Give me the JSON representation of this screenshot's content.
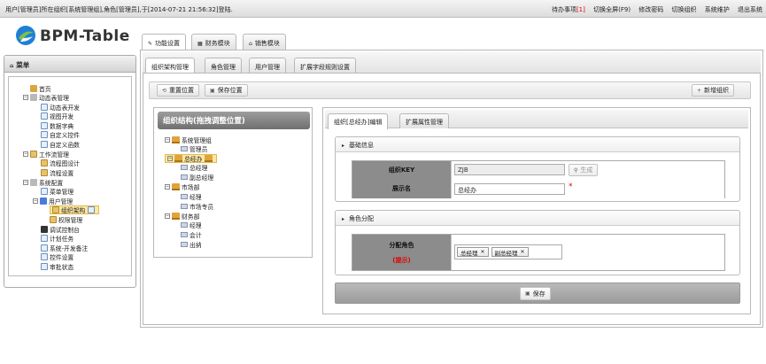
{
  "header": {
    "login_info": "用户[管理员]所在组织[系统管理组],角色[管理员],于[2014-07-21 21:56:32]登陆.",
    "links": {
      "todo_label": "待办事项",
      "todo_count": "[1]",
      "fullscreen": "切换全屏(F9)",
      "change_password": "修改密码",
      "switch_org": "切换组织",
      "system_maintenance": "系统维护",
      "logout": "退出系统"
    }
  },
  "logo": {
    "text": "BPM-Table"
  },
  "sidebar": {
    "title": "菜单",
    "items": [
      {
        "label": "首页"
      },
      {
        "label": "动态表管理"
      },
      {
        "label": "动态表开发"
      },
      {
        "label": "视图开发"
      },
      {
        "label": "数据字典"
      },
      {
        "label": "自定义控件"
      },
      {
        "label": "自定义函数"
      },
      {
        "label": "工作流管理"
      },
      {
        "label": "流程图设计"
      },
      {
        "label": "流程设置"
      },
      {
        "label": "系统配置"
      },
      {
        "label": "菜单管理"
      },
      {
        "label": "用户管理"
      },
      {
        "label": "组织架构"
      },
      {
        "label": "权限管理"
      },
      {
        "label": "调试控制台"
      },
      {
        "label": "计划任务"
      },
      {
        "label": "系统-开发备注"
      },
      {
        "label": "控件设置"
      },
      {
        "label": "审批状态"
      }
    ]
  },
  "top_tabs": [
    {
      "label": "功能设置"
    },
    {
      "label": "财务模块"
    },
    {
      "label": "销售模块"
    }
  ],
  "sub_tabs": [
    {
      "label": "组织架构管理"
    },
    {
      "label": "角色管理"
    },
    {
      "label": "用户管理"
    },
    {
      "label": "扩展字段规则设置"
    }
  ],
  "toolbar": {
    "reset_position": "重置位置",
    "save_position": "保存位置",
    "add_org": "新增组织"
  },
  "org_panel": {
    "title": "组织结构(拖拽调整位置)",
    "nodes": [
      {
        "label": "系统管理组"
      },
      {
        "label": "管理员"
      },
      {
        "label": "总经办"
      },
      {
        "label": "总经理"
      },
      {
        "label": "副总经理"
      },
      {
        "label": "市场部"
      },
      {
        "label": "经理"
      },
      {
        "label": "市场专员"
      },
      {
        "label": "财务部"
      },
      {
        "label": "经理"
      },
      {
        "label": "会计"
      },
      {
        "label": "出纳"
      }
    ]
  },
  "edit_panel": {
    "tabs": [
      {
        "label": "组织[总经办]编辑"
      },
      {
        "label": "扩展属性管理"
      }
    ],
    "basic_info": {
      "title": "基础信息",
      "key_label": "组织KEY",
      "key_value": "ZJB",
      "generate_button": "生成",
      "name_label": "展示名",
      "name_value": "总经办",
      "required_mark": "*"
    },
    "role_assign": {
      "title": "角色分配",
      "label": "分配角色",
      "hint": "(提示)",
      "roles": [
        "总经理",
        "副总经理"
      ]
    },
    "save_button": "保存"
  },
  "colors": {
    "hint_red": "#d00000",
    "selected_bg": "#fbe8a6",
    "label_bg": "#8c8c8c"
  }
}
